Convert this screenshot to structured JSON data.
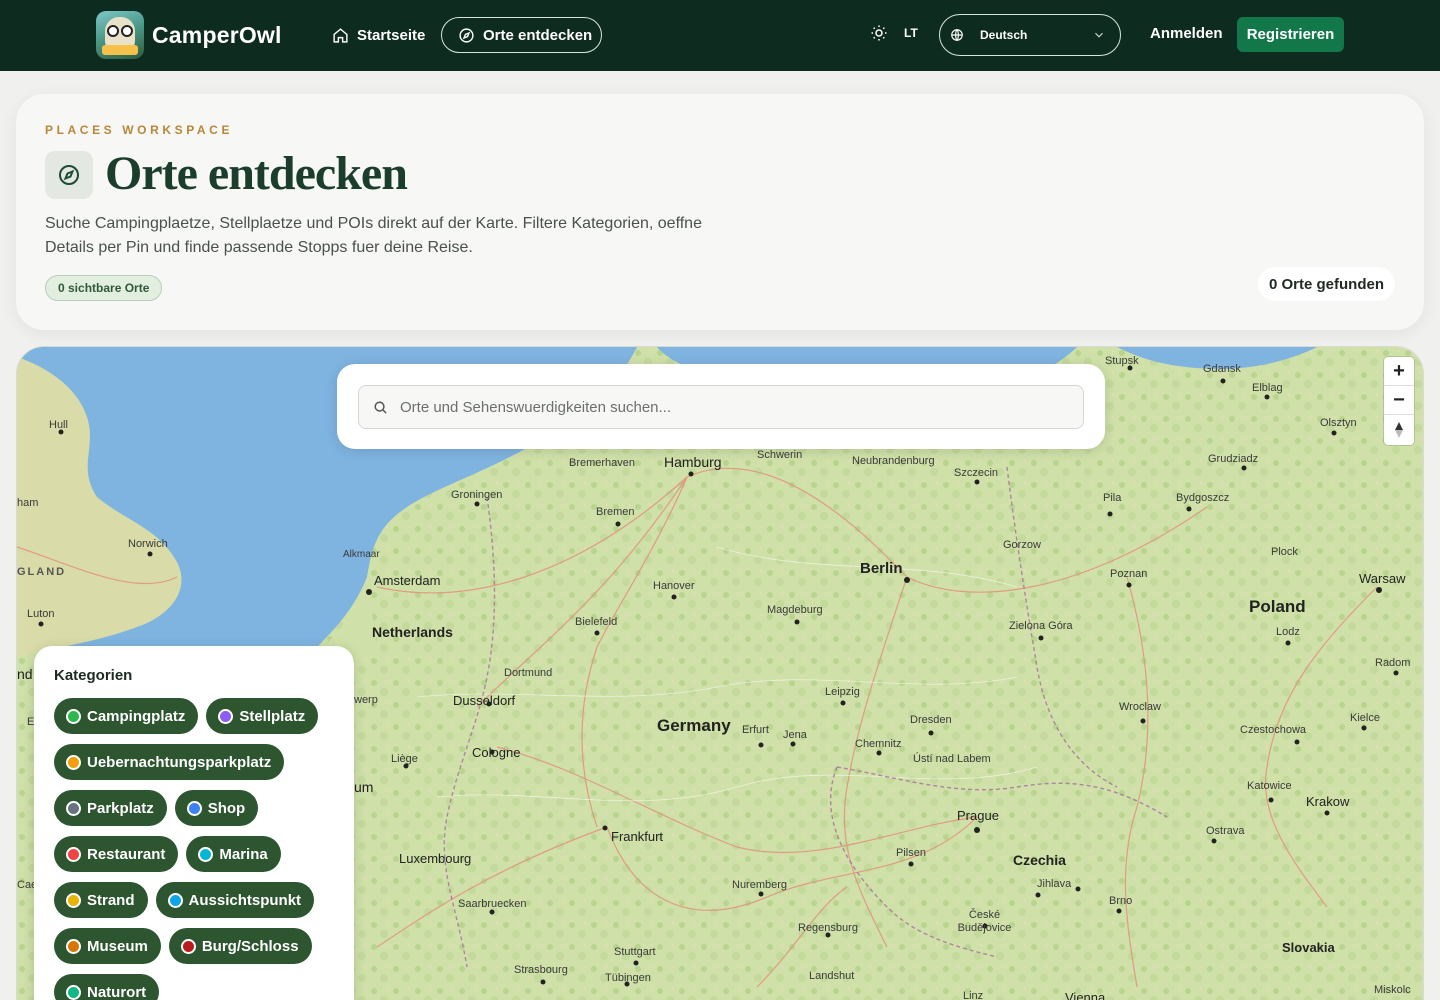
{
  "nav": {
    "brand": "CamperOwl",
    "home_label": "Startseite",
    "discover_label": "Orte entdecken",
    "theme_label": "LT",
    "language": "Deutsch",
    "login_label": "Anmelden",
    "register_label": "Registrieren"
  },
  "hero": {
    "eyebrow": "PLACES WORKSPACE",
    "title": "Orte entdecken",
    "description": "Suche Campingplaetze, Stellplaetze und POIs direkt auf der Karte. Filtere Kategorien, oeffne Details per Pin und finde passende Stopps fuer deine Reise.",
    "visible_count": "0 sichtbare Orte",
    "found_count": "0 Orte gefunden"
  },
  "search": {
    "placeholder": "Orte und Sehenswuerdigkeiten suchen..."
  },
  "map": {
    "zoom_in": "+",
    "zoom_out": "−",
    "labels": [
      "Stupsk",
      "Gdansk",
      "Elblag",
      "Olsztyn",
      "Hull",
      "Bremerhaven",
      "Hamburg",
      "Schwerin",
      "Neubrandenburg",
      "Szczecin",
      "Grudziadz",
      "Pila",
      "Bydgoszcz",
      "Groningen",
      "Bremen",
      "Norwich",
      "Alkmaar",
      "Amsterdam",
      "Hanover",
      "Berlin",
      "Gorzow",
      "Plock",
      "Poznan",
      "Warsaw",
      "Poland",
      "Luton",
      "Netherlands",
      "Bielefeld",
      "Magdeburg",
      "Zielona Góra",
      "Lodz",
      "Dortmund",
      "Leipzig",
      "Radom",
      "Dusseldorf",
      "Germany",
      "Erfurt",
      "Jena",
      "Dresden",
      "Wroclaw",
      "Kielce",
      "Cologne",
      "Chemnitz",
      "Ústí nad Labem",
      "Czestochowa",
      "Liège",
      "Katowice",
      "Krakow",
      "Prague",
      "Frankfurt",
      "Ostrava",
      "Luxembourg",
      "Pilsen",
      "Czechia",
      "Jihlava",
      "Nuremberg",
      "Saarbruecken",
      "Brno",
      "Regensburg",
      "České Budějovice",
      "Stuttgart",
      "Strasbourg",
      "Tübingen",
      "Landshut",
      "Slovakia",
      "Miskolc",
      "Linz",
      "GLAND",
      "ham",
      "nd",
      "um",
      "werp",
      "Cae",
      "E",
      "Vienna"
    ]
  },
  "categories": {
    "title": "Kategorien",
    "items": [
      {
        "label": "Campingplatz",
        "color": "#2db84d",
        "icon": "campground-icon"
      },
      {
        "label": "Stellplatz",
        "color": "#8b5cf6",
        "icon": "parking-spot-icon"
      },
      {
        "label": "Uebernachtungsparkplatz",
        "color": "#f59e0b",
        "icon": "overnight-parking-icon"
      },
      {
        "label": "Parkplatz",
        "color": "#6b7280",
        "icon": "parking-icon"
      },
      {
        "label": "Shop",
        "color": "#3b82f6",
        "icon": "shop-icon"
      },
      {
        "label": "Restaurant",
        "color": "#ef4444",
        "icon": "restaurant-icon"
      },
      {
        "label": "Marina",
        "color": "#06b6d4",
        "icon": "marina-icon"
      },
      {
        "label": "Strand",
        "color": "#eab308",
        "icon": "beach-icon"
      },
      {
        "label": "Aussichtspunkt",
        "color": "#0ea5e9",
        "icon": "viewpoint-icon"
      },
      {
        "label": "Museum",
        "color": "#d97706",
        "icon": "museum-icon"
      },
      {
        "label": "Burg/Schloss",
        "color": "#b91c1c",
        "icon": "castle-icon"
      },
      {
        "label": "Naturort",
        "color": "#10b981",
        "icon": "nature-icon"
      }
    ]
  }
}
